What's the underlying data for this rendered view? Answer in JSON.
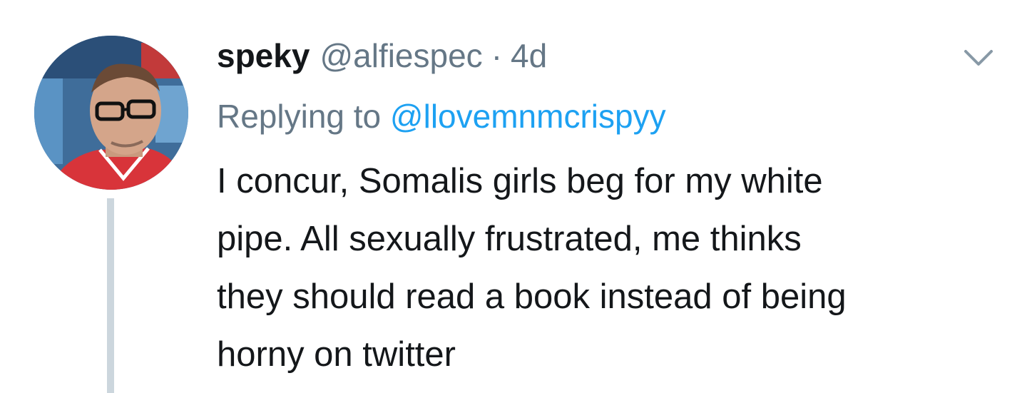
{
  "tweet": {
    "author": {
      "display_name": "speky",
      "handle": "@alfiespec",
      "avatar_icon": "profile-photo"
    },
    "separator": "·",
    "time": "4d",
    "reply": {
      "prefix": "Replying to",
      "to_handle": "@llovemnmcrispyy"
    },
    "text_lines": [
      "I concur, Somalis girls beg for my white",
      "pipe. All sexually frustrated, me thinks",
      "they should read a book instead of being",
      "horny on twitter"
    ],
    "menu_icon": "chevron-down-icon"
  },
  "colors": {
    "primary_text": "#14171a",
    "secondary_text": "#657786",
    "link": "#1da1f2",
    "thread_line": "#ccd6dd"
  }
}
